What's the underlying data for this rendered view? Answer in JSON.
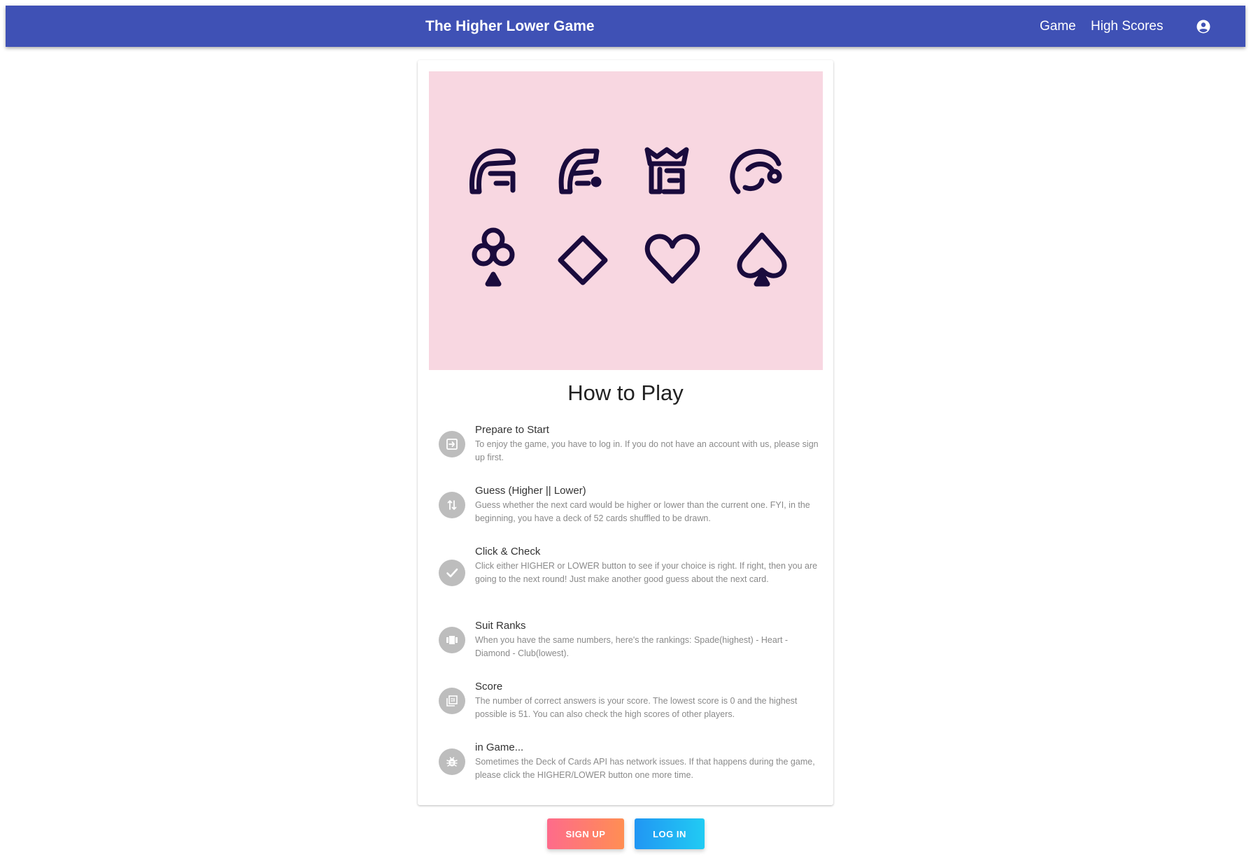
{
  "appbar": {
    "title": "The Higher Lower Game",
    "nav": {
      "game": "Game",
      "high_scores": "High Scores"
    },
    "account_icon": "account-circle-icon",
    "color": "#3f51b5"
  },
  "hero": {
    "background": "#f8d7e1",
    "icons": [
      "jack-icon",
      "queen-icon",
      "king-icon",
      "joker-icon",
      "club-icon",
      "diamond-icon",
      "heart-icon",
      "spade-icon"
    ]
  },
  "how_to_play": {
    "title": "How to Play",
    "steps": [
      {
        "icon": "login-icon",
        "heading": "Prepare to Start",
        "text": "To enjoy the game, you have to log in. If you do not have an account with us, please sign up first."
      },
      {
        "icon": "swap-vertical-icon",
        "heading": "Guess (Higher || Lower)",
        "text": "Guess whether the next card would be higher or lower than the current one. FYI, in the beginning, you have a deck of 52 cards shuffled to be drawn."
      },
      {
        "icon": "check-icon",
        "heading": "Click & Check",
        "text": "Click either HIGHER or LOWER button to see if your choice is right. If right, then you are going to the next round! Just make another good guess about the next card."
      },
      {
        "icon": "view-carousel-icon",
        "heading": "Suit Ranks",
        "text": "When you have the same numbers, here's the rankings: Spade(highest) - Heart - Diamond - Club(lowest)."
      },
      {
        "icon": "score-list-icon",
        "heading": "Score",
        "text": "The number of correct answers is your score. The lowest score is 0 and the highest possible is 51. You can also check the high scores of other players."
      },
      {
        "icon": "bug-icon",
        "heading": "in Game...",
        "text": "Sometimes the Deck of Cards API has network issues. If that happens during the game, please click the HIGHER/LOWER button one more time."
      }
    ]
  },
  "buttons": {
    "signup": "SIGN UP",
    "login": "LOG IN"
  }
}
